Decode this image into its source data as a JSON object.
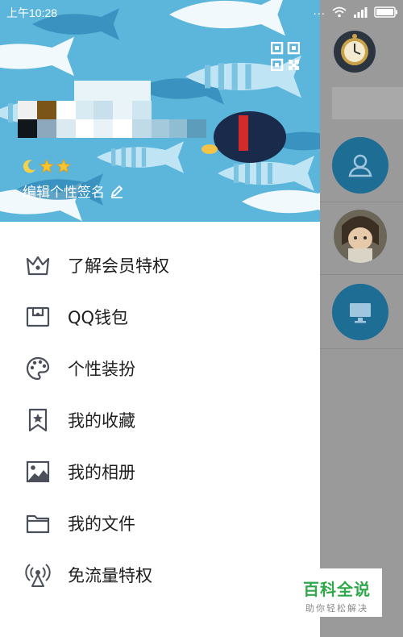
{
  "status_bar": {
    "time": "上午10:28",
    "dots": "...",
    "battery_icon": "battery-icon",
    "wifi_icon": "wifi-icon",
    "signal_icon": "signal-icon"
  },
  "profile": {
    "signature": "编辑个性签名",
    "qr_icon": "qr-code-icon",
    "level_icons": [
      "moon-icon",
      "star-icon",
      "star-icon"
    ]
  },
  "menu": [
    {
      "label": "了解会员特权",
      "icon": "crown-icon"
    },
    {
      "label": "QQ钱包",
      "icon": "wallet-icon"
    },
    {
      "label": "个性装扮",
      "icon": "palette-icon"
    },
    {
      "label": "我的收藏",
      "icon": "bookmark-star-icon"
    },
    {
      "label": "我的相册",
      "icon": "picture-icon"
    },
    {
      "label": "我的文件",
      "icon": "folder-icon"
    },
    {
      "label": "免流量特权",
      "icon": "signal-tower-icon"
    }
  ],
  "watermark": {
    "title": "百科全说",
    "subtitle": "助你轻松解决"
  },
  "colors": {
    "header_bg": "#5cb6dc",
    "accent_blue": "#1e6d94",
    "icon_gray": "#4a4f5a",
    "overlay": "#9a9a9a"
  }
}
